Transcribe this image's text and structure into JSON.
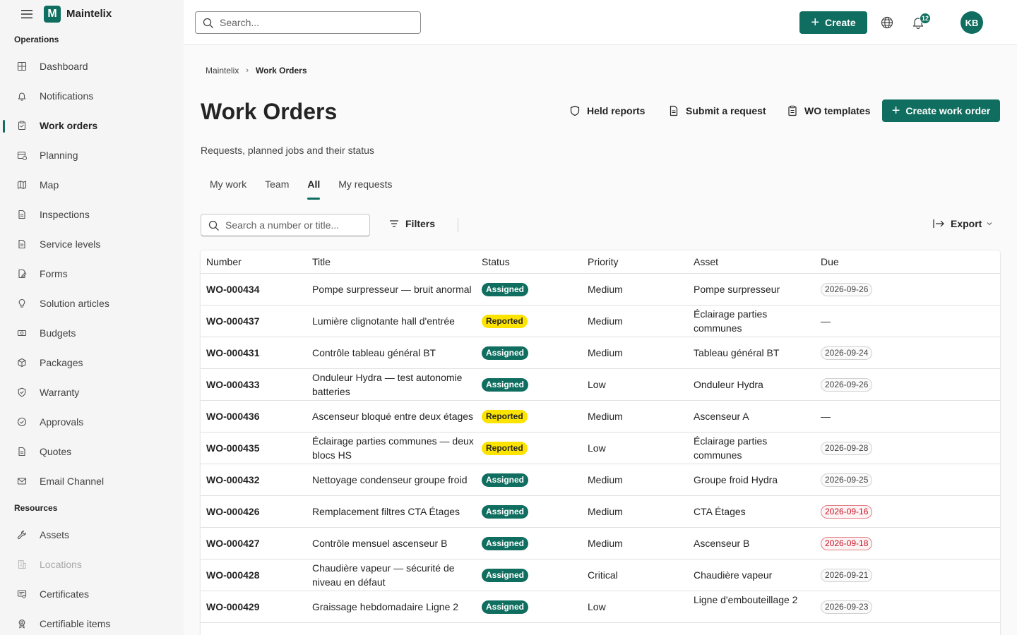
{
  "app": {
    "name": "Maintelix",
    "logo_letter": "M"
  },
  "sidebar": {
    "sections": [
      {
        "label": "Operations",
        "items": [
          {
            "label": "Dashboard",
            "icon": "dashboard-icon"
          },
          {
            "label": "Notifications",
            "icon": "bell-icon"
          },
          {
            "label": "Work orders",
            "icon": "clipboard-icon",
            "active": true
          },
          {
            "label": "Planning",
            "icon": "calendar-icon"
          },
          {
            "label": "Map",
            "icon": "map-icon"
          },
          {
            "label": "Inspections",
            "icon": "document-icon"
          },
          {
            "label": "Service levels",
            "icon": "document-icon"
          },
          {
            "label": "Forms",
            "icon": "form-icon"
          },
          {
            "label": "Solution articles",
            "icon": "lightbulb-icon"
          },
          {
            "label": "Budgets",
            "icon": "money-icon"
          },
          {
            "label": "Packages",
            "icon": "package-icon"
          },
          {
            "label": "Warranty",
            "icon": "shield-icon"
          },
          {
            "label": "Approvals",
            "icon": "check-circle-icon"
          },
          {
            "label": "Quotes",
            "icon": "document-icon"
          },
          {
            "label": "Email Channel",
            "icon": "mail-icon"
          }
        ]
      },
      {
        "label": "Resources",
        "items": [
          {
            "label": "Assets",
            "icon": "wrench-icon"
          },
          {
            "label": "Locations",
            "icon": "building-icon",
            "disabled": true
          },
          {
            "label": "Certificates",
            "icon": "certificate-icon"
          },
          {
            "label": "Certifiable items",
            "icon": "ribbon-icon"
          }
        ]
      }
    ]
  },
  "topbar": {
    "search_placeholder": "Search...",
    "create_label": "Create",
    "notification_count": "12",
    "avatar_initials": "KB"
  },
  "breadcrumb": [
    "Maintelix",
    "Work Orders"
  ],
  "header": {
    "title": "Work Orders",
    "subtitle": "Requests, planned jobs and their status",
    "actions": {
      "held_reports": "Held reports",
      "submit_request": "Submit a request",
      "wo_templates": "WO templates",
      "create_work_order": "Create work order"
    }
  },
  "tabs": [
    {
      "label": "My work"
    },
    {
      "label": "Team"
    },
    {
      "label": "All",
      "active": true
    },
    {
      "label": "My requests"
    }
  ],
  "toolbar": {
    "search_placeholder": "Search a number or title...",
    "filters_label": "Filters",
    "export_label": "Export"
  },
  "table": {
    "columns": [
      "Number",
      "Title",
      "Status",
      "Priority",
      "Asset",
      "Due"
    ],
    "rows": [
      {
        "number": "WO-000434",
        "title": "Pompe surpresseur — bruit anormal",
        "status": "Assigned",
        "priority": "Medium",
        "asset": "Pompe surpresseur",
        "due": "2026-09-26",
        "overdue": false
      },
      {
        "number": "WO-000437",
        "title": "Lumière clignotante hall d'entrée",
        "status": "Reported",
        "priority": "Medium",
        "asset": "Éclairage parties communes",
        "due": "—",
        "overdue": false
      },
      {
        "number": "WO-000431",
        "title": "Contrôle tableau général BT",
        "status": "Assigned",
        "priority": "Medium",
        "asset": "Tableau général BT",
        "due": "2026-09-24",
        "overdue": false
      },
      {
        "number": "WO-000433",
        "title": "Onduleur Hydra — test autonomie batteries",
        "status": "Assigned",
        "priority": "Low",
        "asset": "Onduleur Hydra",
        "due": "2026-09-26",
        "overdue": false
      },
      {
        "number": "WO-000436",
        "title": "Ascenseur bloqué entre deux étages",
        "status": "Reported",
        "priority": "Medium",
        "asset": "Ascenseur A",
        "due": "—",
        "overdue": false
      },
      {
        "number": "WO-000435",
        "title": "Éclairage parties communes — deux blocs HS",
        "status": "Reported",
        "priority": "Low",
        "asset": "Éclairage parties communes",
        "due": "2026-09-28",
        "overdue": false
      },
      {
        "number": "WO-000432",
        "title": "Nettoyage condenseur groupe froid",
        "status": "Assigned",
        "priority": "Medium",
        "asset": "Groupe froid Hydra",
        "due": "2026-09-25",
        "overdue": false
      },
      {
        "number": "WO-000426",
        "title": "Remplacement filtres CTA Étages",
        "status": "Assigned",
        "priority": "Medium",
        "asset": "CTA Étages",
        "due": "2026-09-16",
        "overdue": true
      },
      {
        "number": "WO-000427",
        "title": "Contrôle mensuel ascenseur B",
        "status": "Assigned",
        "priority": "Medium",
        "asset": "Ascenseur B",
        "due": "2026-09-18",
        "overdue": true
      },
      {
        "number": "WO-000428",
        "title": "Chaudière vapeur — sécurité de niveau en défaut",
        "status": "Assigned",
        "priority": "Critical",
        "asset": "Chaudière vapeur",
        "due": "2026-09-21",
        "overdue": false
      },
      {
        "number": "WO-000429",
        "title": "Graissage hebdomadaire Ligne 2",
        "status": "Assigned",
        "priority": "Low",
        "asset": "Ligne d'embouteillage 2",
        "due": "2026-09-23",
        "overdue": false
      }
    ]
  },
  "colors": {
    "accent": "#0f6e5f",
    "reported_badge": "#fde300",
    "overdue": "#c50f1f"
  }
}
